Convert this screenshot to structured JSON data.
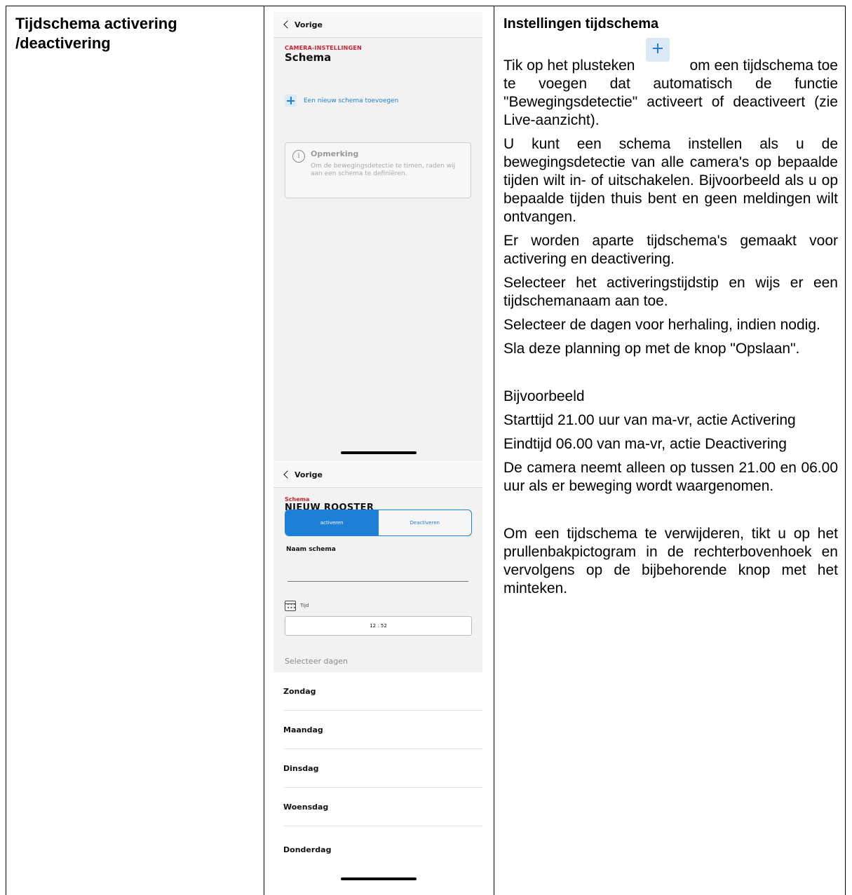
{
  "left_title": "Tijdschema activering /deactivering",
  "screen1": {
    "back_label": "Vorige",
    "section_label": "CAMERA-INSTELLINGEN",
    "title": "Schema",
    "add_label": "Een nieuw schema toevoegen",
    "note_title": "Opmerking",
    "note_text": "Om de bewegingsdetectie te timen, raden wij aan een schema te definiëren."
  },
  "screen2": {
    "back_label": "Vorige",
    "section_label": "Schema",
    "title": "NIEUW ROOSTER",
    "seg_activate": "activeren",
    "seg_deactivate": "Deactiveren",
    "name_label": "Naam schema",
    "time_label": "Tijd",
    "time_value": "12 : 52",
    "select_days": "Selecteer dagen",
    "days": [
      "Zondag",
      "Maandag",
      "Dinsdag",
      "Woensdag",
      "Donderdag"
    ]
  },
  "right": {
    "heading": "Instellingen tijdschema",
    "p1_before": "Tik op het plusteken",
    "p1_after": "om een tijdschema toe te voegen dat automatisch de functie \"Bewegingsdetectie\" activeert of deactiveert (zie Live-aanzicht).",
    "p2": "U kunt een schema instellen als u de bewegingsdetectie van alle camera's op bepaalde tijden wilt in- of uitschakelen. Bijvoorbeeld als u op bepaalde tijden thuis bent en geen meldingen wilt ontvangen.",
    "p3": "Er worden aparte tijdschema's gemaakt voor activering en deactivering.",
    "p4": "Selecteer het activeringstijdstip en wijs er een tijdschemanaam aan toe.",
    "p5": "Selecteer de dagen voor herhaling, indien nodig.",
    "p6": "Sla deze planning op met de knop \"Opslaan\".",
    "example_heading": "Bijvoorbeeld",
    "example1": "Starttijd 21.00 uur van ma-vr, actie Activering",
    "example2": "Eindtijd 06.00 van ma-vr, actie Deactivering",
    "example3": "De camera neemt alleen op tussen 21.00 en 06.00 uur als er beweging wordt waargenomen.",
    "delete_text": "Om een tijdschema te verwijderen, tikt u op het prullenbakpictogram in de rechterbovenhoek en vervolgens op de bijbehorende knop met het minteken."
  }
}
